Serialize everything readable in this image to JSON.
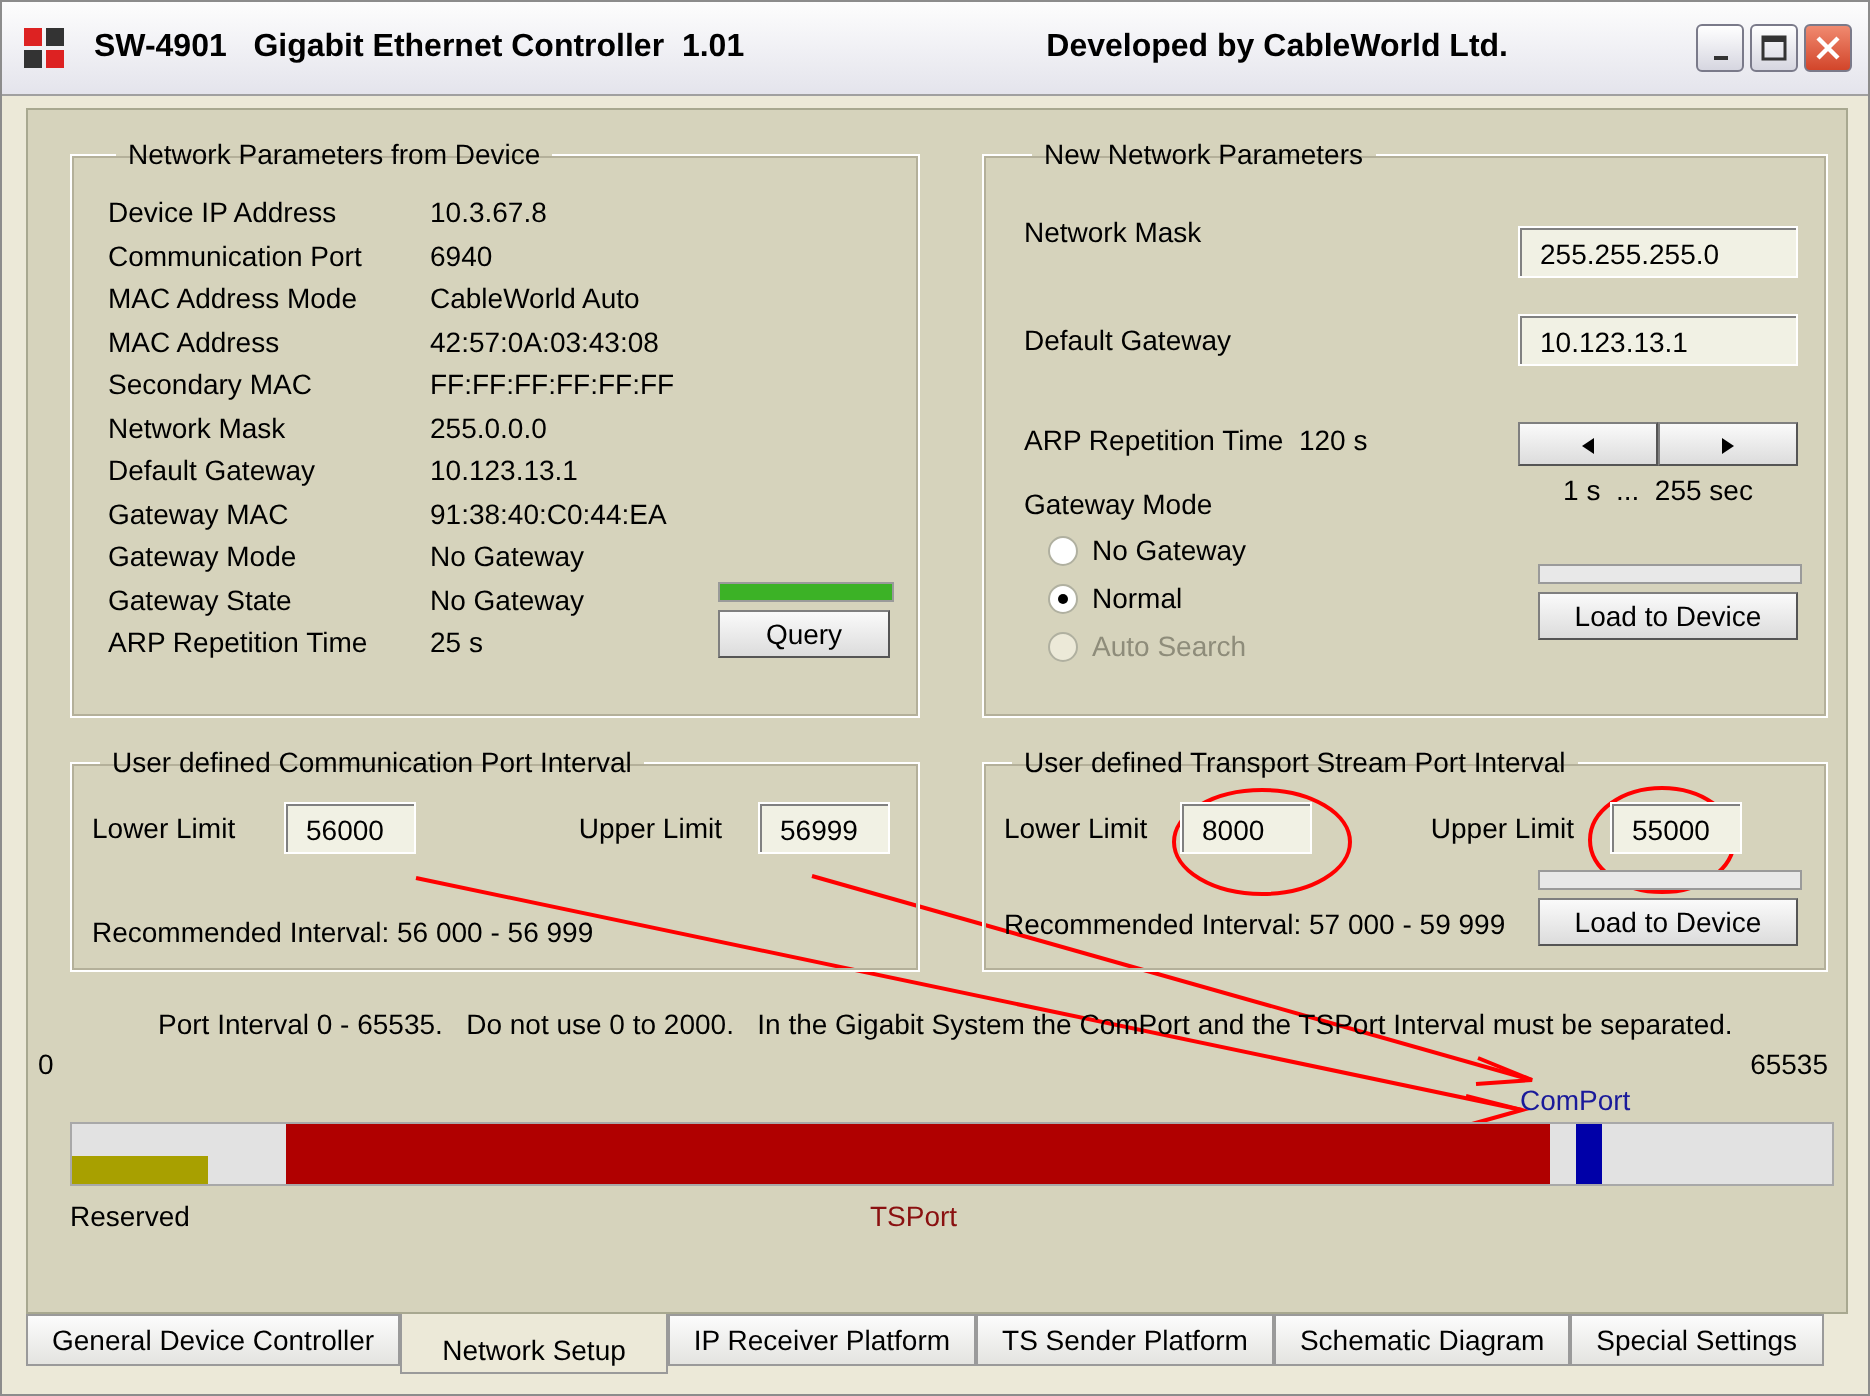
{
  "window": {
    "title": "SW-4901   Gigabit Ethernet Controller  1.01",
    "subtitle": "Developed by CableWorld Ltd."
  },
  "device_params": {
    "title": "Network Parameters from Device",
    "rows": [
      {
        "label": "Device IP Address",
        "value": "10.3.67.8"
      },
      {
        "label": "Communication Port",
        "value": "6940"
      },
      {
        "label": "MAC Address Mode",
        "value": "CableWorld Auto"
      },
      {
        "label": "MAC Address",
        "value": "42:57:0A:03:43:08"
      },
      {
        "label": "Secondary MAC",
        "value": "FF:FF:FF:FF:FF:FF"
      },
      {
        "label": "Network Mask",
        "value": "255.0.0.0"
      },
      {
        "label": "Default Gateway",
        "value": "10.123.13.1"
      },
      {
        "label": "Gateway MAC",
        "value": "91:38:40:C0:44:EA"
      },
      {
        "label": "Gateway Mode",
        "value": "No Gateway"
      },
      {
        "label": "Gateway State",
        "value": "No Gateway"
      },
      {
        "label": "ARP Repetition Time",
        "value": "25 s"
      }
    ],
    "progress": {
      "level": 1
    },
    "button": "Query"
  },
  "new_params": {
    "title": "New Network Parameters",
    "network_mask": {
      "label": "Network Mask",
      "value": "255.255.255.0"
    },
    "default_gateway": {
      "label": "Default Gateway",
      "value": "10.123.13.1"
    },
    "arp": {
      "label": "ARP Repetition Time  120 s",
      "range": "1 s  ...  255 sec"
    },
    "gateway_mode": {
      "label": "Gateway Mode",
      "options": [
        {
          "label": "No Gateway",
          "selected": false,
          "disabled": false
        },
        {
          "label": "Normal",
          "selected": true,
          "disabled": false
        },
        {
          "label": "Auto Search",
          "selected": false,
          "disabled": true
        }
      ]
    },
    "button": "Load to Device"
  },
  "com_interval": {
    "title": "User defined Communication Port Interval",
    "lower": {
      "label": "Lower Limit",
      "value": "56000"
    },
    "upper": {
      "label": "Upper Limit",
      "value": "56999"
    },
    "recommended": "Recommended Interval:  56 000 - 56 999"
  },
  "ts_interval": {
    "title": "User defined Transport Stream Port Interval",
    "lower": {
      "label": "Lower Limit",
      "value": "8000"
    },
    "upper": {
      "label": "Upper Limit",
      "value": "55000"
    },
    "recommended": "Recommended Interval: 57 000 - 59 999",
    "button": "Load to Device"
  },
  "port_map": {
    "note": "Port Interval 0 - 65535.   Do not use 0 to 2000.   In the Gigabit System the ComPort and the TSPort Interval must be separated.",
    "min": "0",
    "max": "65535",
    "reserved": {
      "label": "Reserved",
      "level": 0.077
    },
    "comport_label": "ComPort",
    "tsport_label": "TSPort"
  },
  "tabs": [
    {
      "label": "General Device Controller",
      "selected": false
    },
    {
      "label": "Network Setup",
      "selected": true
    },
    {
      "label": "IP Receiver Platform",
      "selected": false
    },
    {
      "label": "TS Sender Platform",
      "selected": false
    },
    {
      "label": "Schematic Diagram",
      "selected": false
    },
    {
      "label": "Special Settings",
      "selected": false
    }
  ]
}
